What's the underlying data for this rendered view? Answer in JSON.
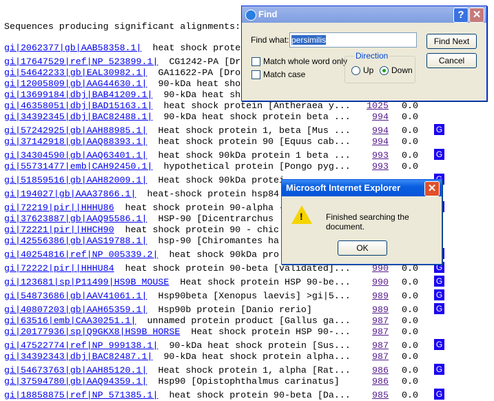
{
  "heading": "Sequences producing significant alignments:",
  "colors": {
    "link": "#0000ee",
    "visited": "#551a8b",
    "gene_icon": "#1a00f0"
  },
  "rows": [
    {
      "id": "gi|2062377|gb|AAB58358.1|",
      "desc": "heat shock prote",
      "score": "",
      "evalue": "",
      "g": false
    },
    {
      "id": "gi|17647529|ref|NP_523899.1|",
      "desc": "CG1242-PA [Dr",
      "score": "",
      "evalue": "",
      "g": false
    },
    {
      "id": "gi|54642233|gb|EAL30982.1|",
      "desc": "GA11622-PA [Dro",
      "score": "",
      "evalue": "",
      "g": false
    },
    {
      "id": "gi|12005809|gb|AAG44630.1|",
      "desc": "90-kDa heat sho",
      "score": "",
      "evalue": "",
      "g": false
    },
    {
      "id": "gi|13699184|dbj|BAB41209.1|",
      "desc": "90-kDa heat sh",
      "score": "",
      "evalue": "",
      "g": false
    },
    {
      "id": "gi|46358051|dbj|BAD15163.1|",
      "desc": "heat shock protein [Antheraea y...",
      "score": "1025",
      "evalue": "0.0",
      "g": false
    },
    {
      "id": "gi|34392345|dbj|BAC82488.1|",
      "desc": "90-kDa heat shock protein beta ...",
      "score": "994",
      "evalue": "0.0",
      "g": false
    },
    {
      "id": "gi|57242925|gb|AAH88985.1|",
      "desc": "Heat shock protein 1, beta [Mus ...",
      "score": "994",
      "evalue": "0.0",
      "g": true
    },
    {
      "id": "gi|37142918|gb|AAQ88393.1|",
      "desc": "heat shock protein 90 [Equus cab...",
      "score": "994",
      "evalue": "0.0",
      "g": false
    },
    {
      "id": "gi|34304590|gb|AAQ63401.1|",
      "desc": "heat shock 90kDa protein 1 beta ...",
      "score": "993",
      "evalue": "0.0",
      "g": true
    },
    {
      "id": "gi|55731477|emb|CAH92450.1|",
      "desc": "hypothetical protein [Pongo pyg...",
      "score": "993",
      "evalue": "0.0",
      "g": false
    },
    {
      "id": "gi|51859516|gb|AAH82009.1|",
      "desc": "Heat shock 90kDa protei",
      "score": "",
      "evalue": "",
      "g": true
    },
    {
      "id": "gi|194027|gb|AAA37866.1|",
      "desc": "heat-shock protein hsp84",
      "score": "",
      "evalue": "",
      "g": false
    },
    {
      "id": "gi|72219|pir||HHHU86",
      "desc": "heat shock protein 90-alpha -",
      "score": "",
      "evalue": "",
      "g": true
    },
    {
      "id": "gi|37623887|gb|AAQ95586.1|",
      "desc": "HSP-90 [Dicentrarchus",
      "score": "",
      "evalue": "",
      "g": false
    },
    {
      "id": "gi|72221|pir||HHCH90",
      "desc": "heat shock protein 90 - chic",
      "score": "",
      "evalue": "",
      "g": false
    },
    {
      "id": "gi|42556386|gb|AAS19788.1|",
      "desc": "hsp-90 [Chiromantes ha",
      "score": "",
      "evalue": "",
      "g": false
    },
    {
      "id": "gi|40254816|ref|NP_005339.2|",
      "desc": "heat shock 90kDa pro",
      "score": "",
      "evalue": "",
      "g": true
    },
    {
      "id": "gi|72222|pir||HHHU84",
      "desc": "heat shock protein 90-beta [validated]...",
      "score": "990",
      "evalue": "0.0",
      "g": true
    },
    {
      "id": "gi|123681|sp|P11499|HS9B_MOUSE",
      "desc": "Heat shock protein HSP 90-be...",
      "score": "990",
      "evalue": "0.0",
      "g": true
    },
    {
      "id": "gi|54873686|gb|AAV41061.1|",
      "desc": "Hsp90beta [Xenopus laevis] >gi|5...",
      "score": "989",
      "evalue": "0.0",
      "g": true
    },
    {
      "id": "gi|40807203|gb|AAH65359.1|",
      "desc": "Hsp90b protein [Danio rerio]",
      "score": "989",
      "evalue": "0.0",
      "g": true
    },
    {
      "id": "gi|63516|emb|CAA30251.1|",
      "desc": "unnamed protein product [Gallus ga...",
      "score": "987",
      "evalue": "0.0",
      "g": false
    },
    {
      "id": "gi|20177936|sp|Q9GKX8|HS9B_HORSE",
      "desc": "Heat shock protein HSP 90-...",
      "score": "987",
      "evalue": "0.0",
      "g": false
    },
    {
      "id": "gi|47522774|ref|NP_999138.1|",
      "desc": "90-kDa heat shock protein [Sus...",
      "score": "987",
      "evalue": "0.0",
      "g": true
    },
    {
      "id": "gi|34392343|dbj|BAC82487.1|",
      "desc": "90-kDa heat shock protein alpha...",
      "score": "987",
      "evalue": "0.0",
      "g": false
    },
    {
      "id": "gi|54673763|gb|AAH85120.1|",
      "desc": "Heat shock protein 1, alpha [Rat...",
      "score": "986",
      "evalue": "0.0",
      "g": true
    },
    {
      "id": "gi|37594780|gb|AAQ94359.1|",
      "desc": "Hsp90 [Opistophthalmus carinatus]",
      "score": "986",
      "evalue": "0.0",
      "g": false
    },
    {
      "id": "gi|18858875|ref|NP_571385.1|",
      "desc": "heat shock protein 90-beta [Da...",
      "score": "985",
      "evalue": "0.0",
      "g": true
    }
  ],
  "gene_icon_label": "G",
  "find_dialog": {
    "title": "Find",
    "find_what_label": "Find what:",
    "find_what_value": "persimilis",
    "match_whole_word": "Match whole word only",
    "match_whole_word_checked": false,
    "match_case": "Match case",
    "match_case_checked": false,
    "direction_label": "Direction",
    "up_label": "Up",
    "down_label": "Down",
    "direction_selected": "Down",
    "find_next": "Find Next",
    "cancel": "Cancel",
    "help": "?",
    "close": "✕"
  },
  "alert": {
    "title": "Microsoft Internet Explorer",
    "message": "Finished searching the document.",
    "ok": "OK",
    "close": "✕"
  }
}
